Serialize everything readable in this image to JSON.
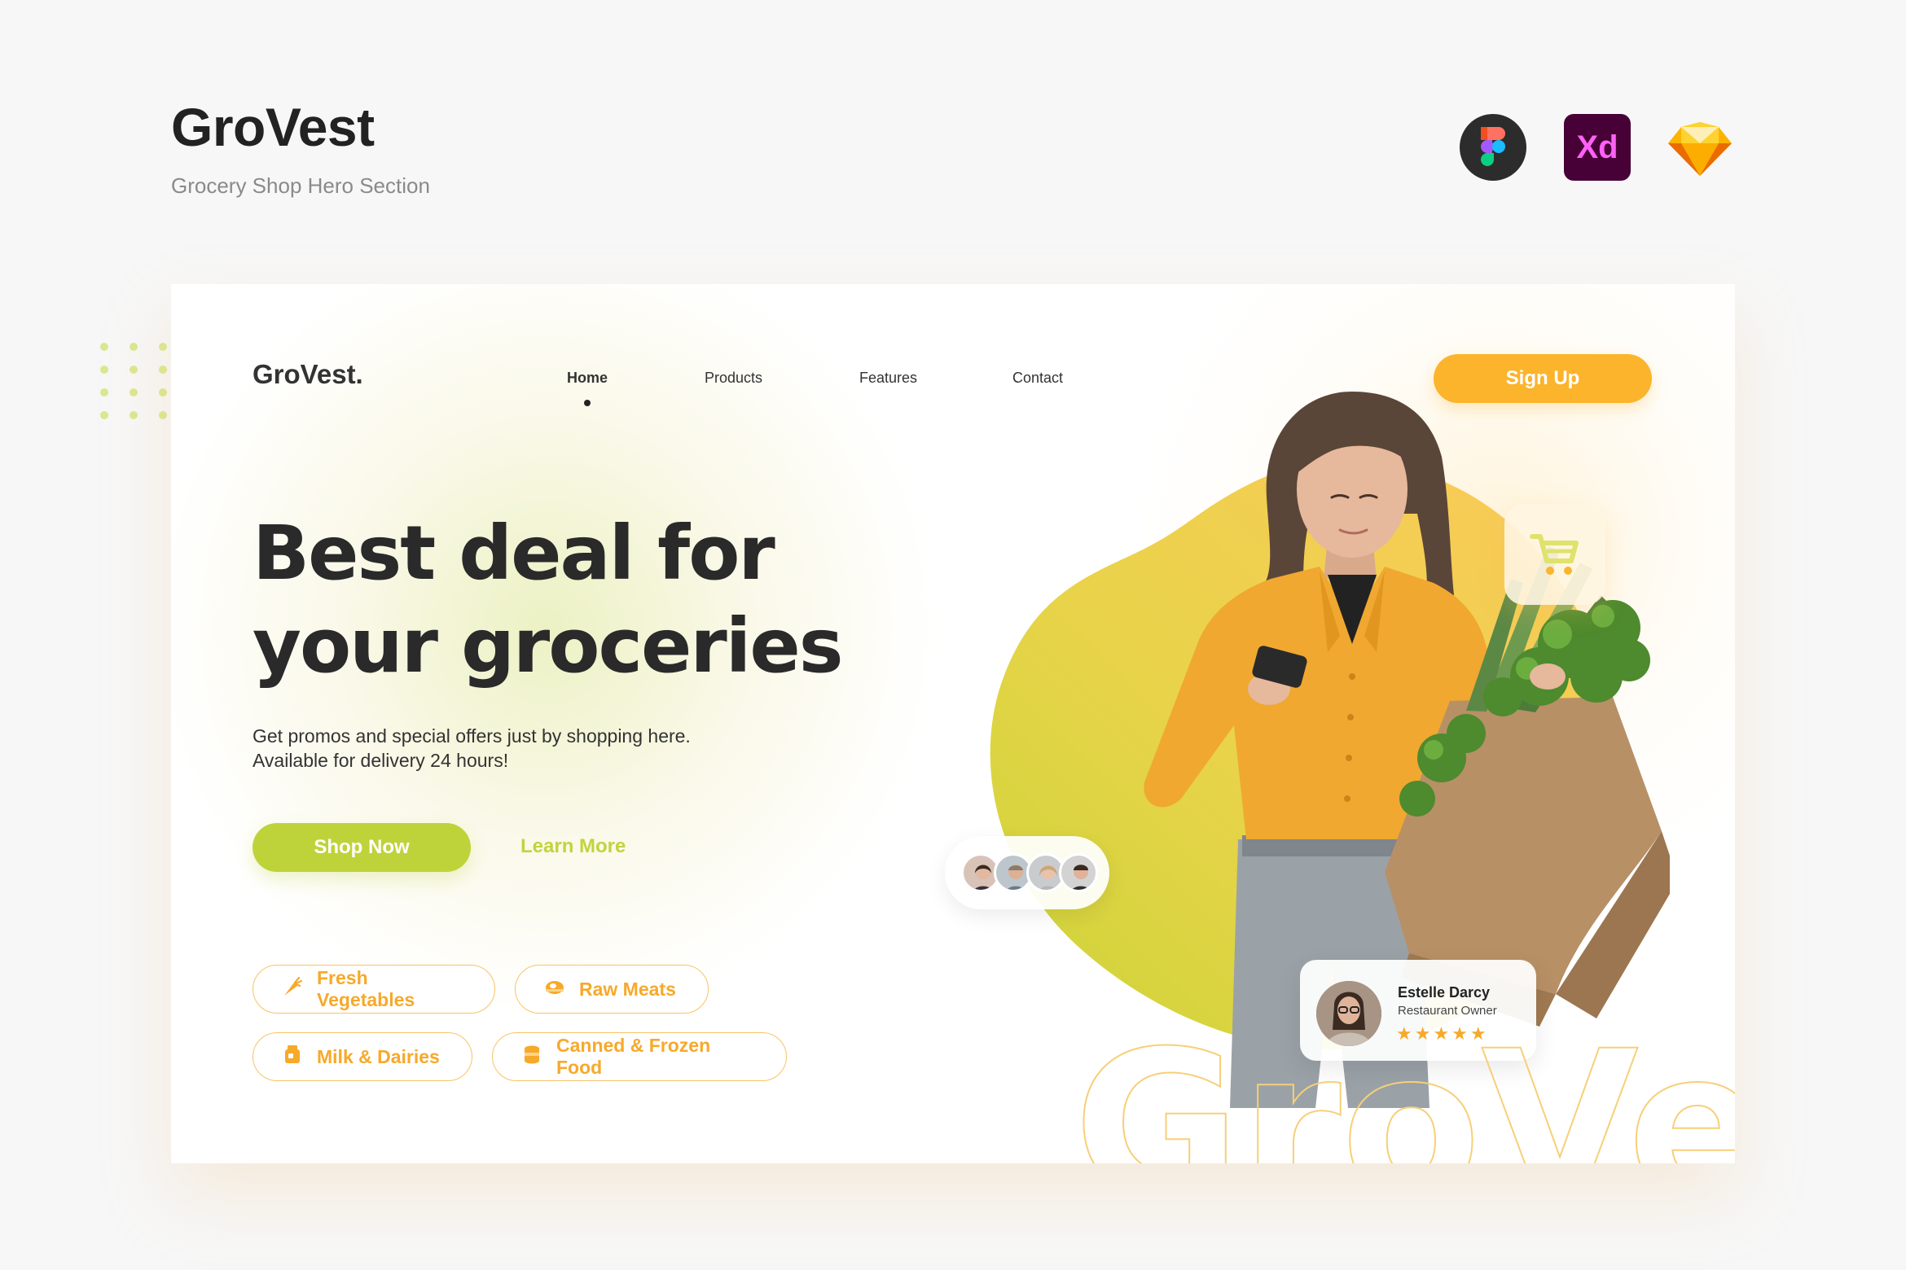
{
  "presentation": {
    "title": "GroVest",
    "subtitle": "Grocery Shop Hero Section",
    "tools": [
      "figma-icon",
      "adobe-xd-icon",
      "sketch-icon"
    ],
    "xd_label": "Xd"
  },
  "hero": {
    "logo": "GroVest.",
    "nav": [
      {
        "label": "Home",
        "active": true
      },
      {
        "label": "Products",
        "active": false
      },
      {
        "label": "Features",
        "active": false
      },
      {
        "label": "Contact",
        "active": false
      }
    ],
    "signup_label": "Sign Up",
    "headline_line1": "Best deal for",
    "headline_line2": "your groceries",
    "desc_line1": "Get promos and special offers just by shopping here.",
    "desc_line2": "Available for delivery 24 hours!",
    "shop_now_label": "Shop Now",
    "learn_more_label": "Learn More",
    "categories": [
      {
        "label": "Fresh Vegetables",
        "icon": "carrot-icon"
      },
      {
        "label": "Raw Meats",
        "icon": "meat-icon"
      },
      {
        "label": "Milk & Dairies",
        "icon": "milk-icon"
      },
      {
        "label": "Canned & Frozen Food",
        "icon": "canned-food-icon"
      }
    ],
    "review": {
      "name": "Estelle Darcy",
      "role": "Restaurant Owner",
      "stars": "★★★★★",
      "rating": 5
    },
    "watermark_text": "GroVe"
  },
  "colors": {
    "primary_orange": "#fbb42c",
    "primary_green": "#bed33a",
    "text_dark": "#2a2a2a"
  }
}
